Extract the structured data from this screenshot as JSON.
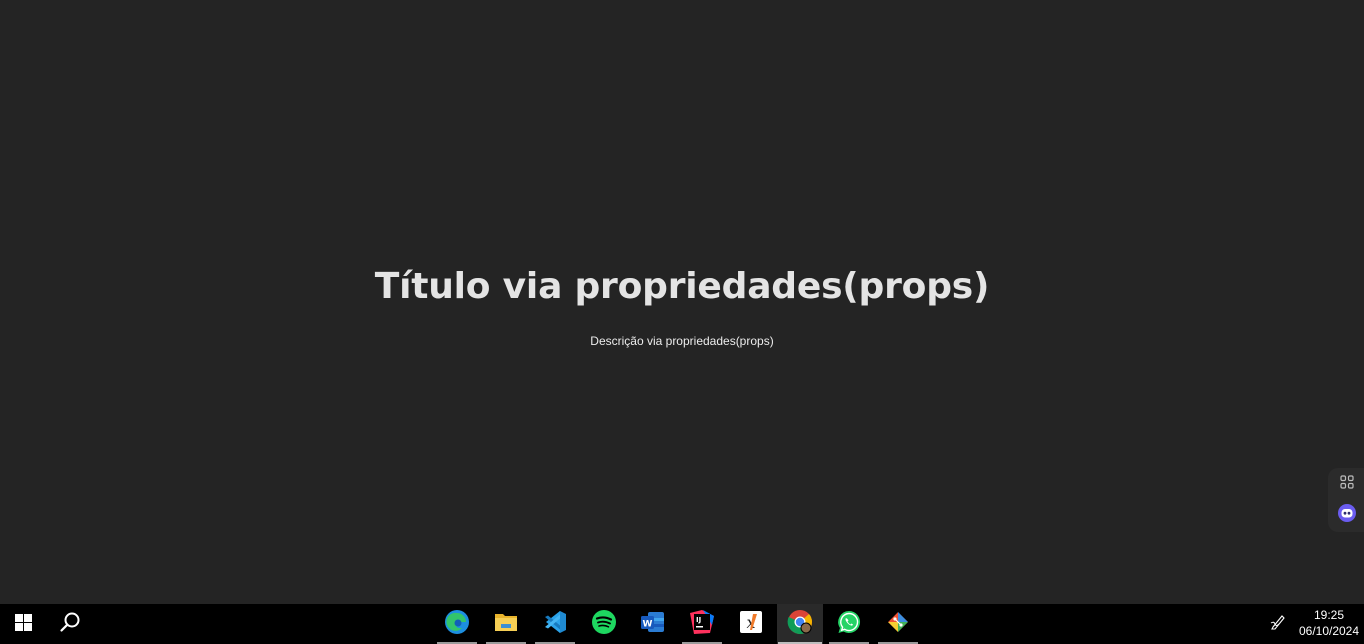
{
  "main": {
    "title": "Título via propriedades(props)",
    "description": "Descrição via propriedades(props)"
  },
  "side_widget": {
    "items": [
      {
        "icon": "grid-icon"
      },
      {
        "icon": "bot-icon"
      }
    ]
  },
  "taskbar": {
    "start_icon": "windows-start-icon",
    "search_icon": "search-icon",
    "apps": [
      {
        "name": "Microsoft Edge",
        "icon": "edge-icon",
        "active": false
      },
      {
        "name": "File Explorer",
        "icon": "folder-icon",
        "active": false
      },
      {
        "name": "Visual Studio Code",
        "icon": "vscode-icon",
        "active": false
      },
      {
        "name": "Spotify",
        "icon": "spotify-icon",
        "active": false
      },
      {
        "name": "Word",
        "icon": "word-icon",
        "active": false
      },
      {
        "name": "IntelliJ IDEA",
        "icon": "intellij-icon",
        "active": false
      },
      {
        "name": "XAMPP",
        "icon": "xampp-icon",
        "active": false
      },
      {
        "name": "Google Chrome",
        "icon": "chrome-icon",
        "active": true
      },
      {
        "name": "WhatsApp",
        "icon": "whatsapp-icon",
        "active": false
      },
      {
        "name": "Git",
        "icon": "git-icon",
        "active": false
      }
    ],
    "tray": {
      "pen_icon": "pen-icon",
      "time": "19:25",
      "date": "06/10/2024"
    }
  },
  "colors": {
    "background": "#242424",
    "taskbar": "#000000",
    "title_text": "#e4e4e4"
  }
}
